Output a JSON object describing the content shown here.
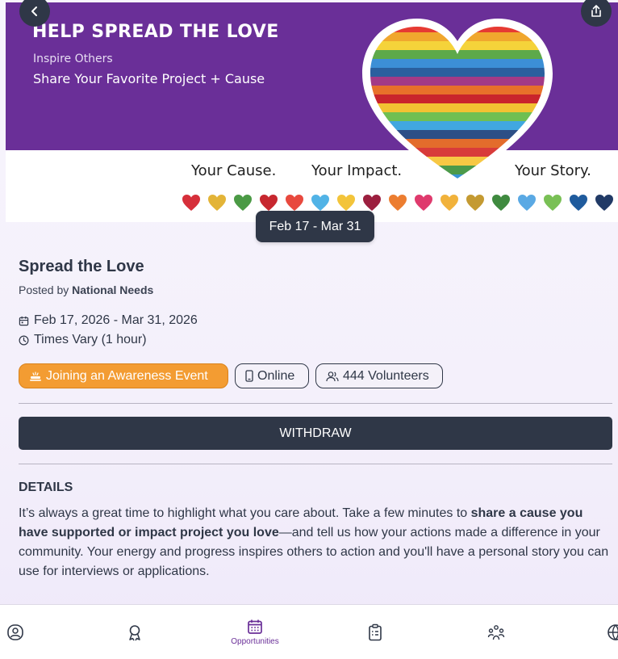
{
  "banner": {
    "title": "HELP SPREAD THE LOVE",
    "subtitle1": "Inspire Others",
    "subtitle2": "Share Your Favorite Project + Cause",
    "tag1": "Your Cause.",
    "tag2": "Your Impact.",
    "tag3": "Your Story.",
    "stripe_colors": [
      "#e63a33",
      "#f0a72e",
      "#f5d33a",
      "#5da94a",
      "#3c8fd6",
      "#2a5f9e",
      "#a33a86",
      "#e8702a",
      "#c9242c",
      "#f2c232",
      "#6fbf52",
      "#41a7e0",
      "#2d4f86",
      "#e36c2c",
      "#d83b3a",
      "#f7c844",
      "#4c9a4a",
      "#3794d4",
      "#243f72"
    ],
    "small_heart_colors": [
      "#d62f3a",
      "#e3b437",
      "#4b9a45",
      "#c7272f",
      "#e8493e",
      "#51b3e6",
      "#f3c43a",
      "#9c1f3f",
      "#ec7d30",
      "#df3a6d",
      "#f1b23b",
      "#c49a32",
      "#3f8a3f",
      "#5aa9e4",
      "#79c055",
      "#1f5b9d",
      "#213a66"
    ]
  },
  "nav_buttons": {
    "back_icon": "chevron-left-icon",
    "share_icon": "share-icon"
  },
  "date_pill": "Feb 17 - Mar 31",
  "event": {
    "title": "Spread the Love",
    "posted_by_prefix": "Posted by",
    "posted_by": "National Needs",
    "date_range": "Feb 17, 2026 - Mar 31, 2026",
    "time": "Times Vary (1 hour)"
  },
  "chips": {
    "category": "Joining an Awareness Event",
    "mode": "Online",
    "volunteers": "444 Volunteers"
  },
  "withdraw_label": "WITHDRAW",
  "details": {
    "heading": "DETAILS",
    "text_1": "It’s always a great time to highlight what you care about. Take a few minutes to ",
    "text_bold": "share a cause you have supported or impact project you love",
    "text_2": "—and tell us how your actions made a difference in your community. Your energy and progress inspires others to action and you'll have a personal story you can use for interviews or applications."
  },
  "bottom_nav": {
    "active_label": "Opportunities",
    "accent": "#6a2f98"
  }
}
